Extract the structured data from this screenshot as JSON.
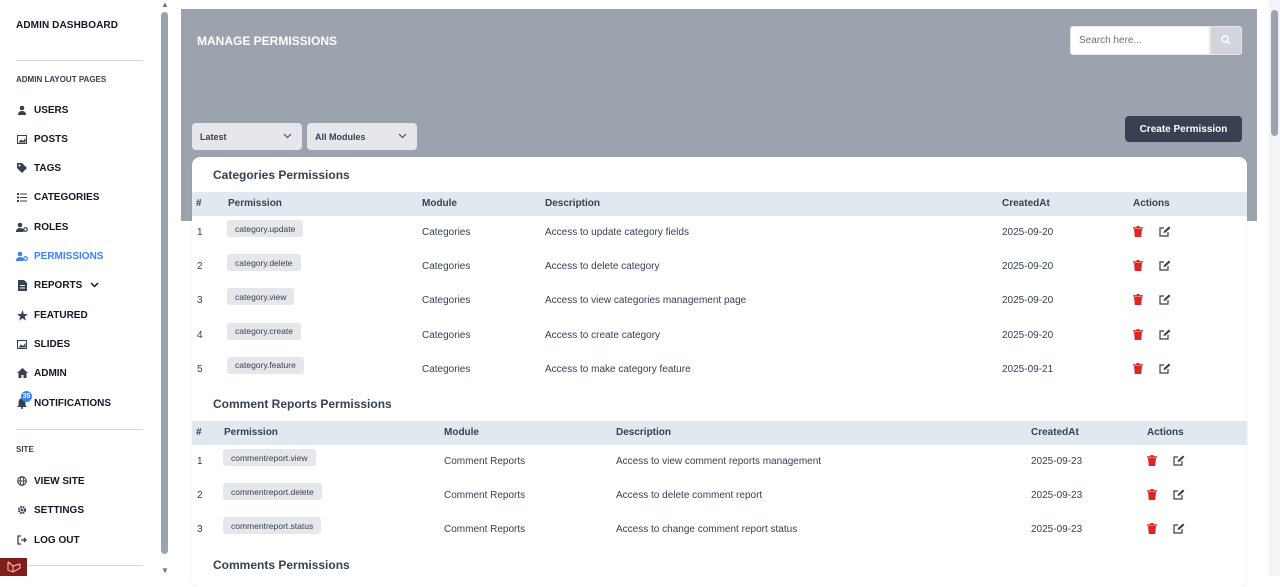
{
  "sidebar": {
    "brand": "ADMIN DASHBOARD",
    "section_layout": "ADMIN LAYOUT PAGES",
    "items": [
      {
        "label": "USERS",
        "icon": "user-icon"
      },
      {
        "label": "POSTS",
        "icon": "image-icon"
      },
      {
        "label": "TAGS",
        "icon": "tag-icon"
      },
      {
        "label": "CATEGORIES",
        "icon": "list-icon"
      },
      {
        "label": "ROLES",
        "icon": "user-gear-icon"
      },
      {
        "label": "PERMISSIONS",
        "icon": "user-gear-icon",
        "active": true
      },
      {
        "label": "REPORTS",
        "icon": "file-icon",
        "has_chevron": true
      },
      {
        "label": "FEATURED",
        "icon": "star-icon"
      },
      {
        "label": "SLIDES",
        "icon": "image-icon"
      },
      {
        "label": "ADMIN",
        "icon": "home-icon"
      },
      {
        "label": "NOTIFICATIONS",
        "icon": "bell-icon",
        "badge": "35"
      }
    ],
    "section_site": "SITE",
    "site_items": [
      {
        "label": "VIEW SITE",
        "icon": "globe-icon"
      },
      {
        "label": "SETTINGS",
        "icon": "gear-icon"
      },
      {
        "label": "LOG OUT",
        "icon": "logout-icon"
      }
    ],
    "active_color": "#3b82f6"
  },
  "header": {
    "title": "MANAGE PERMISSIONS",
    "search_placeholder": "Search here...",
    "bg_color": "#9ca3af"
  },
  "filters": {
    "sort": "Latest",
    "module": "All Modules"
  },
  "create_button": "Create Permission",
  "table_headers": {
    "num": "#",
    "permission": "Permission",
    "module": "Module",
    "description": "Description",
    "created": "CreatedAt",
    "actions": "Actions"
  },
  "sections": [
    {
      "title": "Categories Permissions",
      "rows": [
        {
          "num": "1",
          "permission": "category.update",
          "module": "Categories",
          "description": "Access to update category fields",
          "created": "2025-09-20"
        },
        {
          "num": "2",
          "permission": "category.delete",
          "module": "Categories",
          "description": "Access to delete category",
          "created": "2025-09-20"
        },
        {
          "num": "3",
          "permission": "category.view",
          "module": "Categories",
          "description": "Access to view categories management page",
          "created": "2025-09-20"
        },
        {
          "num": "4",
          "permission": "category.create",
          "module": "Categories",
          "description": "Access to create category",
          "created": "2025-09-20"
        },
        {
          "num": "5",
          "permission": "category.feature",
          "module": "Categories",
          "description": "Access to make category feature",
          "created": "2025-09-21"
        }
      ]
    },
    {
      "title": "Comment Reports Permissions",
      "rows": [
        {
          "num": "1",
          "permission": "commentreport.view",
          "module": "Comment Reports",
          "description": "Access to view comment reports management",
          "created": "2025-09-23"
        },
        {
          "num": "2",
          "permission": "commentreport.delete",
          "module": "Comment Reports",
          "description": "Access to delete comment report",
          "created": "2025-09-23"
        },
        {
          "num": "3",
          "permission": "commentreport.status",
          "module": "Comment Reports",
          "description": "Access to change comment report status",
          "created": "2025-09-23"
        }
      ]
    },
    {
      "title": "Comments Permissions",
      "rows": []
    }
  ],
  "colors": {
    "delete_icon": "#dc2626",
    "table_header_bg": "#e2e8f0",
    "create_button_bg": "#374151"
  }
}
